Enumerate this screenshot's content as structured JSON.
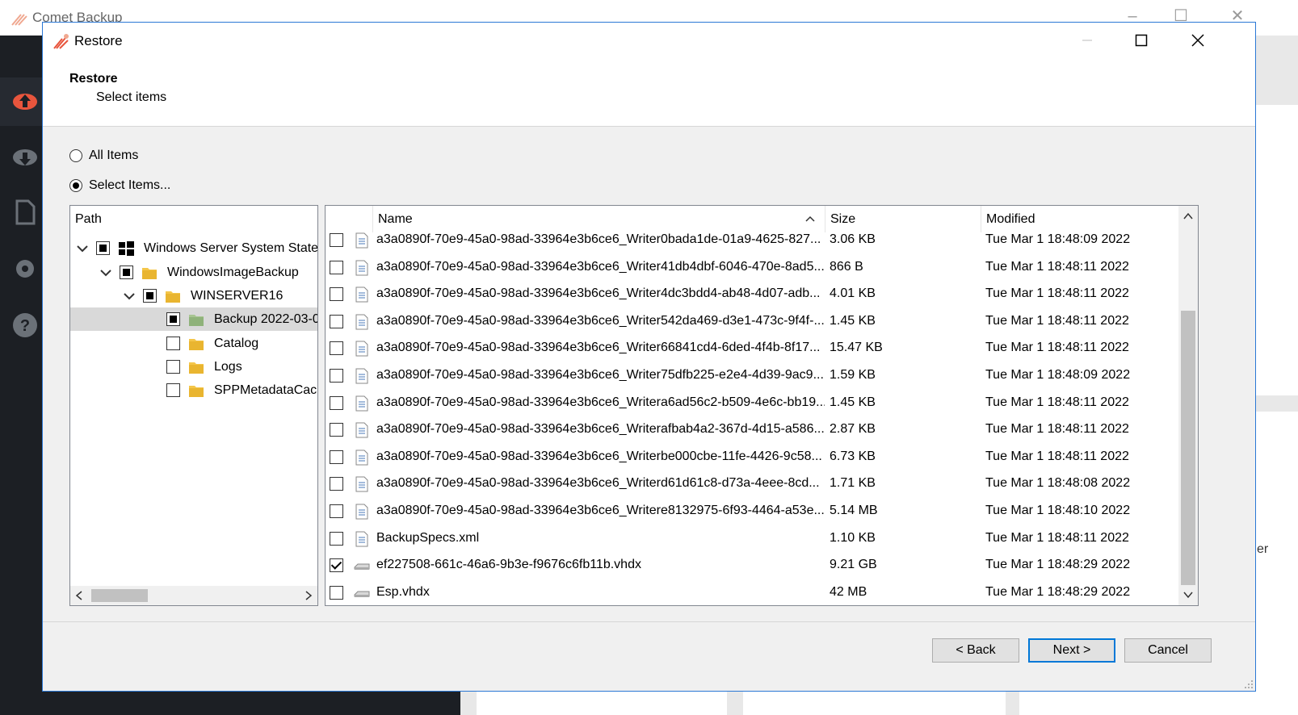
{
  "app": {
    "title": "Comet Backup",
    "card_text_fragment": "er"
  },
  "dialog": {
    "title": "Restore",
    "header_title": "Restore",
    "header_subtitle": "Select items",
    "radio_all": "All Items",
    "radio_select": "Select Items...",
    "selected_radio": "select"
  },
  "tree": {
    "header": "Path",
    "items": [
      {
        "label": "Windows Server System State",
        "level": 0,
        "expanded": true,
        "state": "partial",
        "icon": "windows-icon"
      },
      {
        "label": "WindowsImageBackup",
        "level": 1,
        "expanded": true,
        "state": "partial",
        "icon": "folder-icon"
      },
      {
        "label": "WINSERVER16",
        "level": 2,
        "expanded": true,
        "state": "partial",
        "icon": "folder-icon"
      },
      {
        "label": "Backup 2022-03-0",
        "level": 3,
        "expanded": false,
        "state": "partial",
        "icon": "folder-icon",
        "selected": true
      },
      {
        "label": "Catalog",
        "level": 3,
        "expanded": false,
        "state": "unchecked",
        "icon": "folder-icon"
      },
      {
        "label": "Logs",
        "level": 3,
        "expanded": false,
        "state": "unchecked",
        "icon": "folder-icon"
      },
      {
        "label": "SPPMetadataCach",
        "level": 3,
        "expanded": false,
        "state": "unchecked",
        "icon": "folder-icon"
      }
    ]
  },
  "list": {
    "columns": {
      "name": "Name",
      "size": "Size",
      "modified": "Modified"
    },
    "sort_column": "name",
    "sort_direction": "ascending",
    "rows": [
      {
        "name": "a3a0890f-70e9-45a0-98ad-33964e3b6ce6_Writer0bada1de-01a9-4625-827...",
        "size": "3.06 KB",
        "modified": "Tue Mar 1 18:48:09 2022",
        "checked": false,
        "icon": "xml-file-icon"
      },
      {
        "name": "a3a0890f-70e9-45a0-98ad-33964e3b6ce6_Writer41db4dbf-6046-470e-8ad5...",
        "size": "866 B",
        "modified": "Tue Mar 1 18:48:11 2022",
        "checked": false,
        "icon": "xml-file-icon"
      },
      {
        "name": "a3a0890f-70e9-45a0-98ad-33964e3b6ce6_Writer4dc3bdd4-ab48-4d07-adb...",
        "size": "4.01 KB",
        "modified": "Tue Mar 1 18:48:11 2022",
        "checked": false,
        "icon": "xml-file-icon"
      },
      {
        "name": "a3a0890f-70e9-45a0-98ad-33964e3b6ce6_Writer542da469-d3e1-473c-9f4f-...",
        "size": "1.45 KB",
        "modified": "Tue Mar 1 18:48:11 2022",
        "checked": false,
        "icon": "xml-file-icon"
      },
      {
        "name": "a3a0890f-70e9-45a0-98ad-33964e3b6ce6_Writer66841cd4-6ded-4f4b-8f17...",
        "size": "15.47 KB",
        "modified": "Tue Mar 1 18:48:11 2022",
        "checked": false,
        "icon": "xml-file-icon"
      },
      {
        "name": "a3a0890f-70e9-45a0-98ad-33964e3b6ce6_Writer75dfb225-e2e4-4d39-9ac9...",
        "size": "1.59 KB",
        "modified": "Tue Mar 1 18:48:09 2022",
        "checked": false,
        "icon": "xml-file-icon"
      },
      {
        "name": "a3a0890f-70e9-45a0-98ad-33964e3b6ce6_Writera6ad56c2-b509-4e6c-bb19...",
        "size": "1.45 KB",
        "modified": "Tue Mar 1 18:48:11 2022",
        "checked": false,
        "icon": "xml-file-icon"
      },
      {
        "name": "a3a0890f-70e9-45a0-98ad-33964e3b6ce6_Writerafbab4a2-367d-4d15-a586...",
        "size": "2.87 KB",
        "modified": "Tue Mar 1 18:48:11 2022",
        "checked": false,
        "icon": "xml-file-icon"
      },
      {
        "name": "a3a0890f-70e9-45a0-98ad-33964e3b6ce6_Writerbe000cbe-11fe-4426-9c58...",
        "size": "6.73 KB",
        "modified": "Tue Mar 1 18:48:11 2022",
        "checked": false,
        "icon": "xml-file-icon"
      },
      {
        "name": "a3a0890f-70e9-45a0-98ad-33964e3b6ce6_Writerd61d61c8-d73a-4eee-8cd...",
        "size": "1.71 KB",
        "modified": "Tue Mar 1 18:48:08 2022",
        "checked": false,
        "icon": "xml-file-icon"
      },
      {
        "name": "a3a0890f-70e9-45a0-98ad-33964e3b6ce6_Writere8132975-6f93-4464-a53e...",
        "size": "5.14 MB",
        "modified": "Tue Mar 1 18:48:10 2022",
        "checked": false,
        "icon": "xml-file-icon"
      },
      {
        "name": "BackupSpecs.xml",
        "size": "1.10 KB",
        "modified": "Tue Mar 1 18:48:11 2022",
        "checked": false,
        "icon": "xml-file-icon"
      },
      {
        "name": "ef227508-661c-46a6-9b3e-f9676c6fb11b.vhdx",
        "size": "9.21 GB",
        "modified": "Tue Mar 1 18:48:29 2022",
        "checked": true,
        "icon": "disk-image-icon"
      },
      {
        "name": "Esp.vhdx",
        "size": "42 MB",
        "modified": "Tue Mar 1 18:48:29 2022",
        "checked": false,
        "icon": "disk-image-icon"
      }
    ]
  },
  "buttons": {
    "back": "< Back",
    "next": "Next >",
    "cancel": "Cancel"
  },
  "colors": {
    "accent": "#2b78d5",
    "brand": "#e8553d",
    "sidebar_bg": "#1c1f24"
  }
}
